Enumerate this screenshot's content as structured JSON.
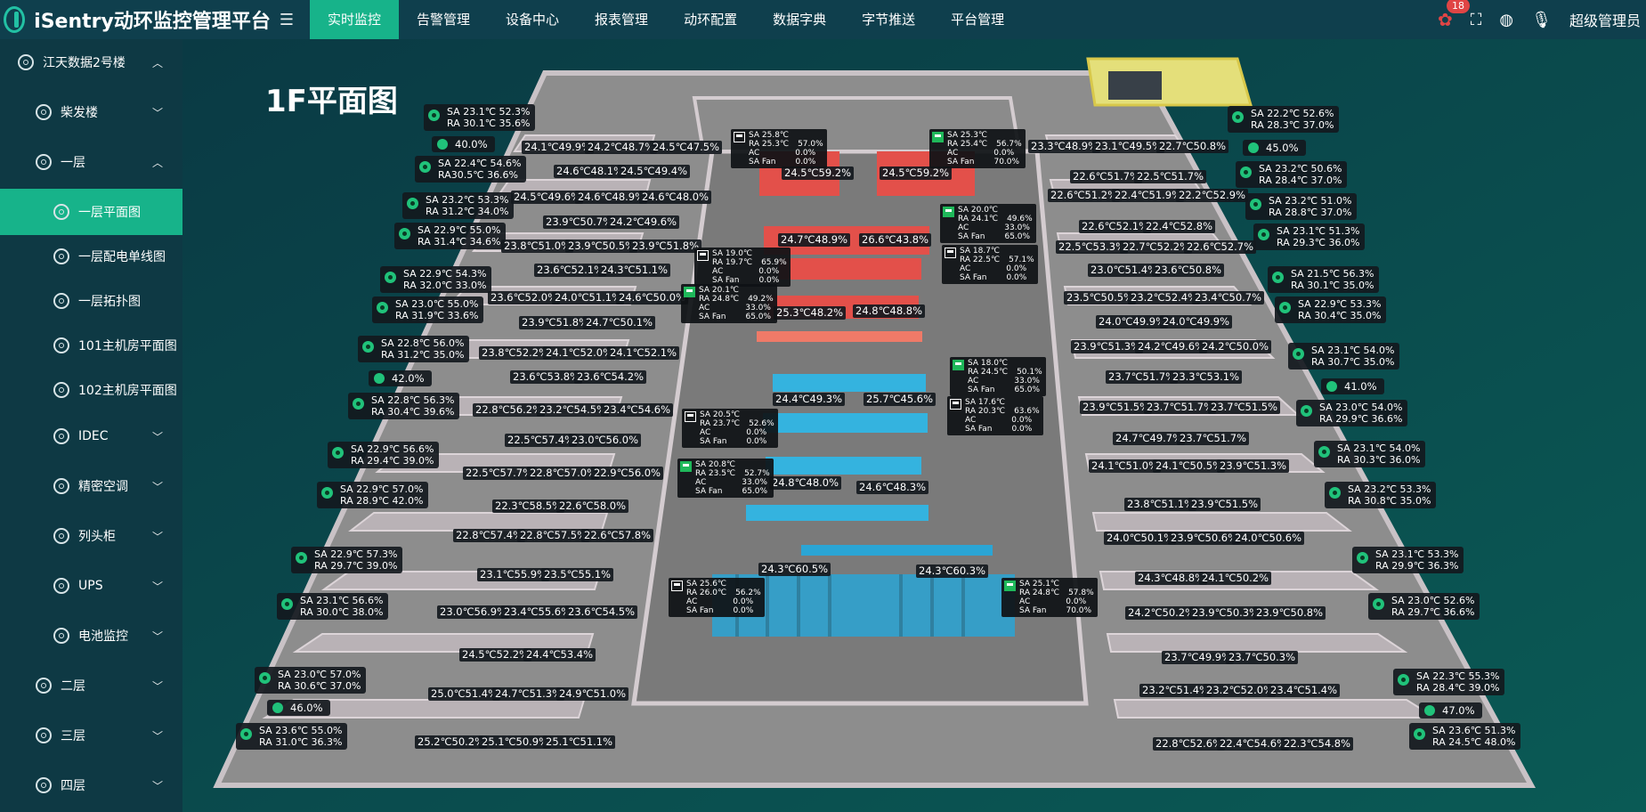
{
  "header": {
    "app_title": "iSentry动环监控管理平台",
    "nav": [
      "实时监控",
      "告警管理",
      "设备中心",
      "报表管理",
      "动环配置",
      "数据字典",
      "字节推送",
      "平台管理"
    ],
    "alarm_count": "18",
    "user": "超级管理员"
  },
  "sidebar": {
    "items": [
      "江天数据2号楼",
      "柴发楼",
      "一层",
      "一层平面图",
      "一层配电单线图",
      "一层拓扑图",
      "101主机房平面图",
      "102主机房平面图",
      "IDEC",
      "精密空调",
      "列头柜",
      "UPS",
      "电池监控",
      "二层",
      "三层",
      "四层"
    ]
  },
  "map": {
    "title": "1F平面图",
    "ac_units": [
      {
        "sa": "SA 23.1℃ 52.3%",
        "ra": "RA 30.1℃ 35.6%"
      },
      {
        "sa": "SA 22.4℃ 54.6%",
        "ra": "RA30.5℃ 36.6%"
      },
      {
        "sa": "SA 23.2℃ 53.3%",
        "ra": "RA 31.2℃ 34.0%"
      },
      {
        "sa": "SA 22.9℃ 55.0%",
        "ra": "RA 31.4℃ 34.6%"
      },
      {
        "sa": "SA 22.9℃ 54.3%",
        "ra": "RA 32.0℃ 33.0%"
      },
      {
        "sa": "SA 23.0℃ 55.0%",
        "ra": "RA 31.9℃ 33.6%"
      },
      {
        "sa": "SA 22.8℃ 56.0%",
        "ra": "RA 31.2℃ 35.0%"
      },
      {
        "sa": "SA 22.8℃ 56.3%",
        "ra": "RA 30.4℃ 39.6%"
      },
      {
        "sa": "SA 22.9℃ 56.6%",
        "ra": "RA 29.4℃ 39.0%"
      },
      {
        "sa": "SA 22.9℃ 57.0%",
        "ra": "RA 28.9℃ 42.0%"
      },
      {
        "sa": "SA 22.9℃ 57.3%",
        "ra": "RA 29.7℃ 39.0%"
      },
      {
        "sa": "SA 23.1℃ 56.6%",
        "ra": "RA 30.0℃ 38.0%"
      },
      {
        "sa": "SA 23.0℃ 57.0%",
        "ra": "RA 30.6℃ 37.0%"
      },
      {
        "sa": "SA 23.6℃ 55.0%",
        "ra": "RA 31.0℃ 36.3%"
      },
      {
        "sa": "SA 22.2℃ 52.6%",
        "ra": "RA 28.3℃ 37.0%"
      },
      {
        "sa": "SA 23.2℃ 50.6%",
        "ra": "RA 28.4℃ 37.0%"
      },
      {
        "sa": "SA 23.2℃ 51.0%",
        "ra": "RA 28.8℃ 37.0%"
      },
      {
        "sa": "SA 23.1℃ 51.3%",
        "ra": "RA 29.3℃ 36.0%"
      },
      {
        "sa": "SA 21.5℃ 56.3%",
        "ra": "RA 30.1℃ 35.0%"
      },
      {
        "sa": "SA 22.9℃ 53.3%",
        "ra": "RA 30.4℃ 35.0%"
      },
      {
        "sa": "SA 23.1℃ 54.0%",
        "ra": "RA 30.7℃ 35.0%"
      },
      {
        "sa": "SA 23.0℃ 54.0%",
        "ra": "RA 29.9℃ 36.6%"
      },
      {
        "sa": "SA 23.1℃ 54.0%",
        "ra": "RA 30.3℃ 36.0%"
      },
      {
        "sa": "SA 23.2℃ 53.3%",
        "ra": "RA 30.8℃ 35.0%"
      },
      {
        "sa": "SA 23.1℃ 53.3%",
        "ra": "RA 29.9℃ 36.3%"
      },
      {
        "sa": "SA 23.0℃ 52.6%",
        "ra": "RA 29.7℃ 36.6%"
      },
      {
        "sa": "SA 22.3℃ 55.3%",
        "ra": "RA 28.4℃ 39.0%"
      },
      {
        "sa": "SA 23.6℃ 51.3%",
        "ra": "RA 24.5℃ 48.0%"
      }
    ],
    "humidity": [
      "40.0%",
      "42.0%",
      "46.0%",
      "45.0%",
      "41.0%",
      "47.0%"
    ],
    "sensors": [
      "24.1℃49.9%",
      "24.2℃48.7%",
      "24.5℃47.5%",
      "24.6℃48.1%",
      "24.5℃49.4%",
      "24.5℃49.6%",
      "24.6℃48.9%",
      "24.6℃48.0%",
      "23.9℃50.7%",
      "24.2℃49.6%",
      "23.8℃51.0%",
      "23.9℃50.5%",
      "23.9℃51.8%",
      "23.6℃52.1%",
      "24.3℃51.1%",
      "23.6℃52.0%",
      "24.0℃51.1%",
      "24.6℃50.0%",
      "23.9℃51.8%",
      "24.7℃50.1%",
      "23.8℃52.2%",
      "24.1℃52.0%",
      "24.1℃52.1%",
      "23.6℃53.8%",
      "23.6℃54.2%",
      "22.8℃56.2%",
      "23.2℃54.5%",
      "23.4℃54.6%",
      "22.5℃57.4%",
      "23.0℃56.0%",
      "22.5℃57.7%",
      "22.8℃57.0%",
      "22.9℃56.0%",
      "22.3℃58.5%",
      "22.6℃58.0%",
      "22.8℃57.4%",
      "22.8℃57.5%",
      "22.6℃57.8%",
      "23.1℃55.9%",
      "23.5℃55.1%",
      "23.0℃56.9%",
      "23.4℃55.6%",
      "23.6℃54.5%",
      "24.5℃52.2%",
      "24.4℃53.4%",
      "25.0℃51.4%",
      "24.7℃51.3%",
      "24.9℃51.0%",
      "25.2℃50.2%",
      "25.1℃50.9%",
      "25.1℃51.1%",
      "24.5℃59.2%",
      "24.5℃59.2%",
      "24.7℃48.9%",
      "26.6℃43.8%",
      "25.3℃48.2%",
      "24.8℃48.8%",
      "24.4℃49.3%",
      "25.7℃45.6%",
      "24.8℃48.0%",
      "24.6℃48.3%",
      "24.3℃60.5%",
      "24.3℃60.3%",
      "23.3℃48.9%",
      "23.1℃49.5%",
      "22.7℃50.8%",
      "22.6℃51.7%",
      "22.5℃51.7%",
      "22.6℃51.2%",
      "22.4℃51.9%",
      "22.2℃52.9%",
      "22.6℃52.1%",
      "22.4℃52.8%",
      "22.5℃53.3%",
      "22.7℃52.2%",
      "22.6℃52.7%",
      "23.0℃51.4%",
      "23.6℃50.8%",
      "23.5℃50.5%",
      "23.2℃52.4%",
      "23.4℃50.7%",
      "24.0℃49.9%",
      "24.0℃49.9%",
      "23.9℃51.3%",
      "24.2℃49.6%",
      "24.2℃50.0%",
      "23.7℃51.7%",
      "23.3℃53.1%",
      "23.9℃51.5%",
      "23.7℃51.7%",
      "23.7℃51.5%",
      "24.7℃49.7%",
      "23.7℃51.7%",
      "24.1℃51.0%",
      "24.1℃50.5%",
      "23.9℃51.3%",
      "23.8℃51.1%",
      "23.9℃51.5%",
      "24.0℃50.1%",
      "23.9℃50.6%",
      "24.0℃50.6%",
      "24.3℃48.8%",
      "24.1℃50.2%",
      "24.2℃50.2%",
      "23.9℃50.3%",
      "23.9℃50.8%",
      "23.7℃49.9%",
      "23.7℃50.3%",
      "23.2℃51.4%",
      "23.2℃52.0%",
      "23.4℃51.4%",
      "22.8℃52.6%",
      "22.4℃54.6%",
      "22.3℃54.8%"
    ],
    "crac_units": [
      {
        "sa": "SA 25.8℃",
        "ra": "RA 25.3℃",
        "v1": "57.0%",
        "v2": "0.0%",
        "v3": "0.0%",
        "on": false
      },
      {
        "sa": "SA 25.3℃",
        "ra": "RA 25.4℃",
        "v1": "56.7%",
        "v2": "0.0%",
        "v3": "70.0%",
        "on": true
      },
      {
        "sa": "SA 20.0℃",
        "ra": "RA 24.1℃",
        "v1": "49.6%",
        "v2": "33.0%",
        "v3": "65.0%",
        "on": true
      },
      {
        "sa": "SA 18.7℃",
        "ra": "RA 22.5℃",
        "v1": "57.1%",
        "v2": "0.0%",
        "v3": "0.0%",
        "on": false
      },
      {
        "sa": "SA 19.0℃",
        "ra": "RA 19.7℃",
        "v1": "65.9%",
        "v2": "0.0%",
        "v3": "0.0%",
        "on": false
      },
      {
        "sa": "SA 20.1℃",
        "ra": "RA 24.8℃",
        "v1": "49.2%",
        "v2": "33.0%",
        "v3": "65.0%",
        "on": true
      },
      {
        "sa": "SA 18.0℃",
        "ra": "RA 24.5℃",
        "v1": "50.1%",
        "v2": "33.0%",
        "v3": "65.0%",
        "on": true
      },
      {
        "sa": "SA 17.6℃",
        "ra": "RA 20.3℃",
        "v1": "63.6%",
        "v2": "0.0%",
        "v3": "0.0%",
        "on": false
      },
      {
        "sa": "SA 20.5℃",
        "ra": "RA 23.7℃",
        "v1": "52.6%",
        "v2": "0.0%",
        "v3": "0.0%",
        "on": false
      },
      {
        "sa": "SA 20.8℃",
        "ra": "RA 23.5℃",
        "v1": "52.7%",
        "v2": "33.0%",
        "v3": "65.0%",
        "on": true
      },
      {
        "sa": "SA 25.6℃",
        "ra": "RA 26.0℃",
        "v1": "56.2%",
        "v2": "0.0%",
        "v3": "0.0%",
        "on": false
      },
      {
        "sa": "SA 25.1℃",
        "ra": "RA 24.8℃",
        "v1": "57.8%",
        "v2": "0.0%",
        "v3": "70.0%",
        "on": true
      }
    ],
    "crac_labels": {
      "ac": "AC",
      "fan": "SA Fan"
    }
  }
}
